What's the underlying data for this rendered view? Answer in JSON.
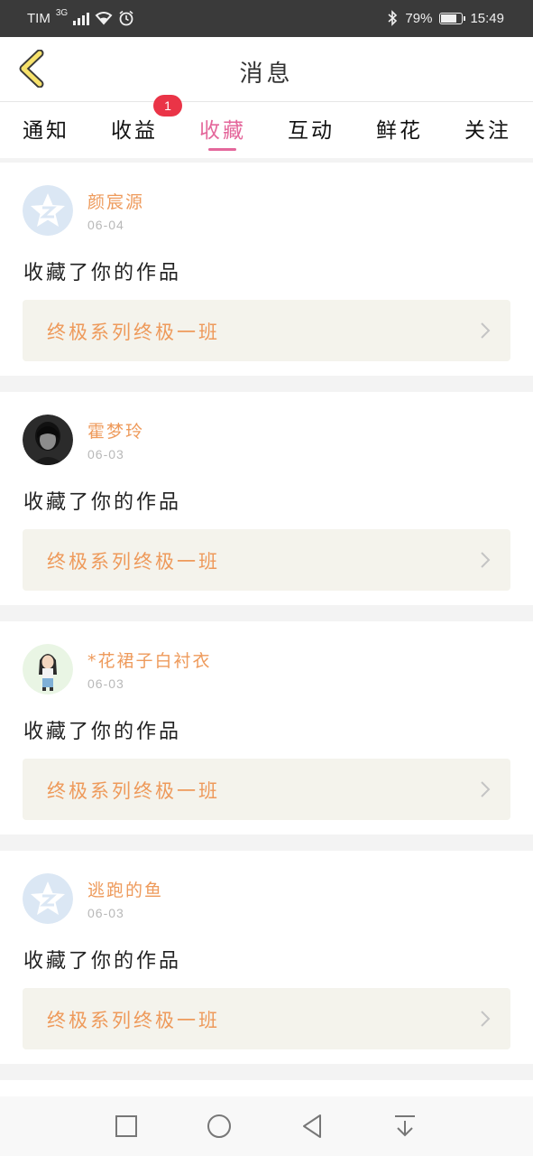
{
  "status_bar": {
    "carrier": "TIM",
    "network": "3G",
    "battery_text": "79%",
    "battery_level": 0.79,
    "time": "15:49"
  },
  "header": {
    "title": "消息",
    "back_icon": "chevron-left-icon"
  },
  "tabs": [
    {
      "label": "通知",
      "active": false
    },
    {
      "label": "收益",
      "active": false,
      "badge": "1"
    },
    {
      "label": "收藏",
      "active": true
    },
    {
      "label": "互动",
      "active": false
    },
    {
      "label": "鲜花",
      "active": false
    },
    {
      "label": "关注",
      "active": false
    }
  ],
  "accent_color": "#e4679b",
  "name_color": "#ee9a5b",
  "badge_color": "#ea3447",
  "items": [
    {
      "username": "颜宸源",
      "date": "06-04",
      "action": "收藏了你的作品",
      "work_title": "终极系列终极一班",
      "avatar": "default-star-avatar"
    },
    {
      "username": "霍梦玲",
      "date": "06-03",
      "action": "收藏了你的作品",
      "work_title": "终极系列终极一班",
      "avatar": "photo-avatar"
    },
    {
      "username": "*花裙子白衬衣",
      "date": "06-03",
      "action": "收藏了你的作品",
      "work_title": "终极系列终极一班",
      "avatar": "cartoon-avatar"
    },
    {
      "username": "逃跑的鱼",
      "date": "06-03",
      "action": "收藏了你的作品",
      "work_title": "终极系列终极一班",
      "avatar": "default-star-avatar"
    }
  ],
  "nav_bar": {
    "buttons": [
      "square-icon",
      "circle-icon",
      "triangle-back-icon",
      "pull-down-icon"
    ]
  }
}
